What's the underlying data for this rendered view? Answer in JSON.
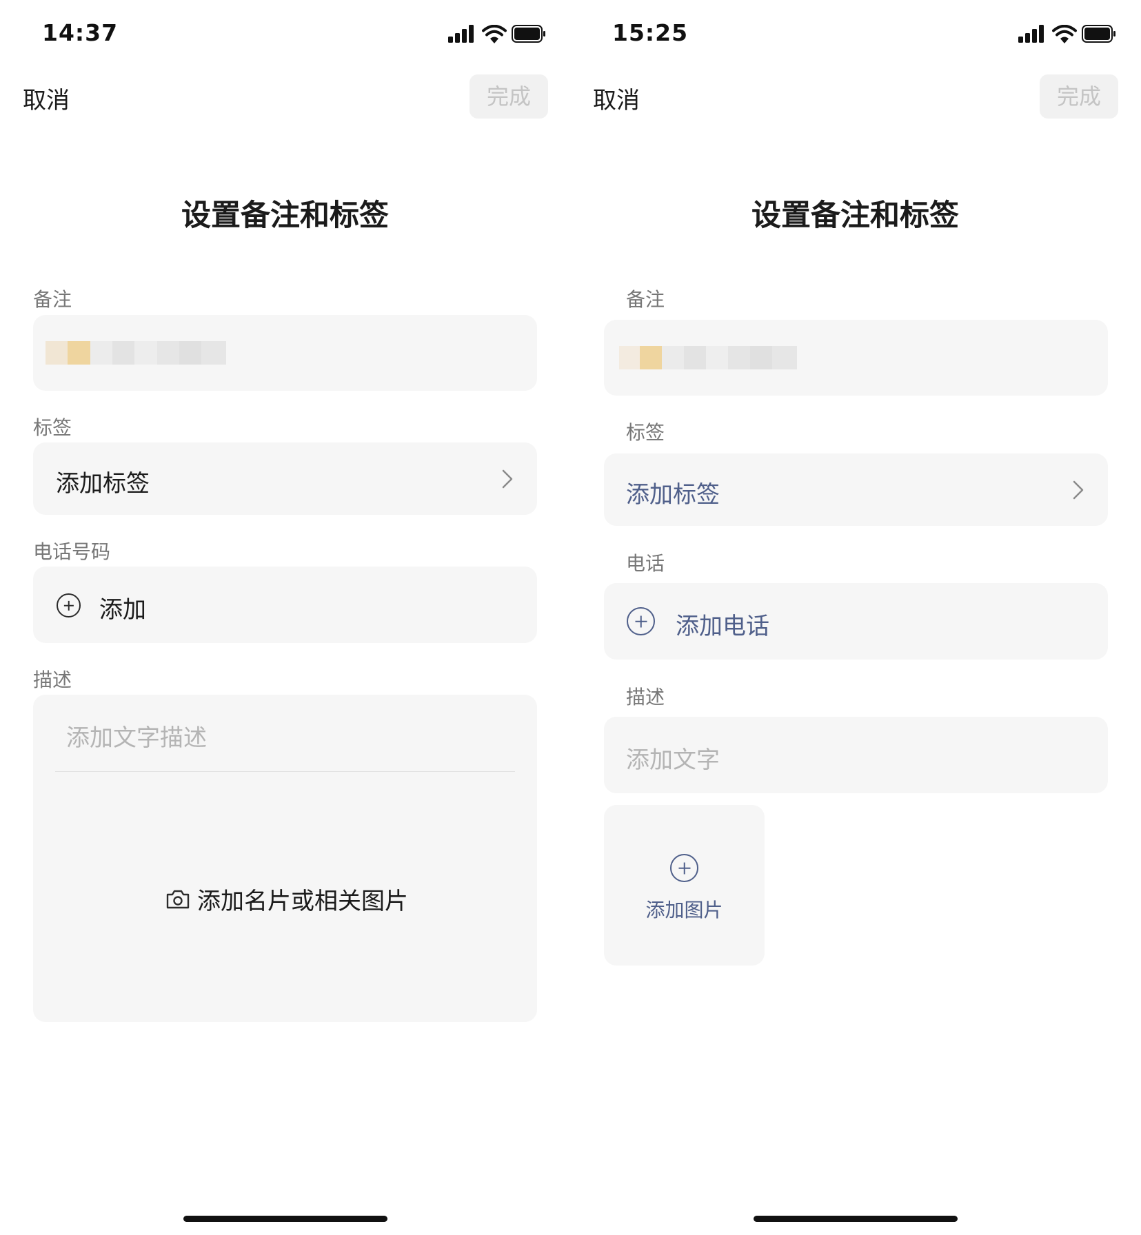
{
  "left": {
    "status": {
      "time": "14:37"
    },
    "nav": {
      "cancel": "取消",
      "done": "完成"
    },
    "title": "设置备注和标签",
    "remark": {
      "label": "备注"
    },
    "tags": {
      "label": "标签",
      "value": "添加标签"
    },
    "phone": {
      "label": "电话号码",
      "add": "添加"
    },
    "description": {
      "label": "描述",
      "placeholder": "添加文字描述",
      "add_image": "添加名片或相关图片"
    }
  },
  "right": {
    "status": {
      "time": "15:25"
    },
    "nav": {
      "cancel": "取消",
      "done": "完成"
    },
    "title": "设置备注和标签",
    "remark": {
      "label": "备注"
    },
    "tags": {
      "label": "标签",
      "value": "添加标签"
    },
    "phone": {
      "label": "电话",
      "add": "添加电话"
    },
    "description": {
      "label": "描述",
      "placeholder": "添加文字",
      "add_image": "添加图片"
    }
  },
  "colors": {
    "accent_blue": "#4f5f8a",
    "card_bg": "#f6f6f6",
    "done_disabled": "#c4c4c4"
  },
  "icons": [
    "cellular-signal-icon",
    "wifi-icon",
    "battery-icon",
    "chevron-right-icon",
    "add-circle-icon",
    "camera-icon"
  ]
}
